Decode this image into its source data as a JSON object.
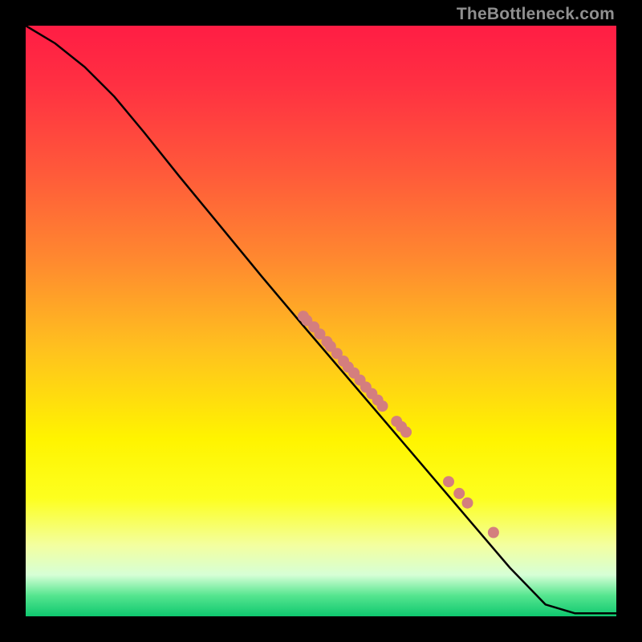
{
  "watermark": {
    "text": "TheBottleneck.com"
  },
  "colors": {
    "curve_stroke": "#000000",
    "point_fill": "#d47e7e",
    "black": "#000000"
  },
  "gradient_stops": [
    {
      "offset": 0.0,
      "color": "#ff1d44"
    },
    {
      "offset": 0.1,
      "color": "#ff3042"
    },
    {
      "offset": 0.25,
      "color": "#ff5a3a"
    },
    {
      "offset": 0.4,
      "color": "#ff8a2f"
    },
    {
      "offset": 0.55,
      "color": "#ffc21e"
    },
    {
      "offset": 0.7,
      "color": "#fff400"
    },
    {
      "offset": 0.8,
      "color": "#fdff1f"
    },
    {
      "offset": 0.88,
      "color": "#f3ffa0"
    },
    {
      "offset": 0.93,
      "color": "#d6ffd6"
    },
    {
      "offset": 0.965,
      "color": "#55e58f"
    },
    {
      "offset": 1.0,
      "color": "#0fc86f"
    }
  ],
  "chart_data": {
    "type": "line",
    "title": "",
    "xlabel": "",
    "ylabel": "",
    "xlim": [
      0,
      1
    ],
    "ylim": [
      0,
      1
    ],
    "curve": [
      {
        "x": 0.0,
        "y": 1.0
      },
      {
        "x": 0.05,
        "y": 0.97
      },
      {
        "x": 0.1,
        "y": 0.93
      },
      {
        "x": 0.15,
        "y": 0.88
      },
      {
        "x": 0.2,
        "y": 0.82
      },
      {
        "x": 0.26,
        "y": 0.745
      },
      {
        "x": 0.33,
        "y": 0.66
      },
      {
        "x": 0.4,
        "y": 0.575
      },
      {
        "x": 0.47,
        "y": 0.492
      },
      {
        "x": 0.54,
        "y": 0.41
      },
      {
        "x": 0.61,
        "y": 0.328
      },
      {
        "x": 0.68,
        "y": 0.246
      },
      {
        "x": 0.75,
        "y": 0.164
      },
      {
        "x": 0.82,
        "y": 0.082
      },
      {
        "x": 0.88,
        "y": 0.02
      },
      {
        "x": 0.93,
        "y": 0.005
      },
      {
        "x": 1.0,
        "y": 0.005
      }
    ],
    "points": [
      {
        "x": 0.47,
        "y": 0.508
      },
      {
        "x": 0.476,
        "y": 0.501
      },
      {
        "x": 0.488,
        "y": 0.49
      },
      {
        "x": 0.498,
        "y": 0.478
      },
      {
        "x": 0.51,
        "y": 0.465
      },
      {
        "x": 0.516,
        "y": 0.457
      },
      {
        "x": 0.527,
        "y": 0.445
      },
      {
        "x": 0.538,
        "y": 0.432
      },
      {
        "x": 0.546,
        "y": 0.422
      },
      {
        "x": 0.556,
        "y": 0.412
      },
      {
        "x": 0.566,
        "y": 0.4
      },
      {
        "x": 0.576,
        "y": 0.388
      },
      {
        "x": 0.586,
        "y": 0.377
      },
      {
        "x": 0.596,
        "y": 0.366
      },
      {
        "x": 0.604,
        "y": 0.356
      },
      {
        "x": 0.628,
        "y": 0.33
      },
      {
        "x": 0.636,
        "y": 0.321
      },
      {
        "x": 0.644,
        "y": 0.312
      },
      {
        "x": 0.716,
        "y": 0.228
      },
      {
        "x": 0.734,
        "y": 0.208
      },
      {
        "x": 0.748,
        "y": 0.192
      },
      {
        "x": 0.792,
        "y": 0.142
      }
    ]
  }
}
